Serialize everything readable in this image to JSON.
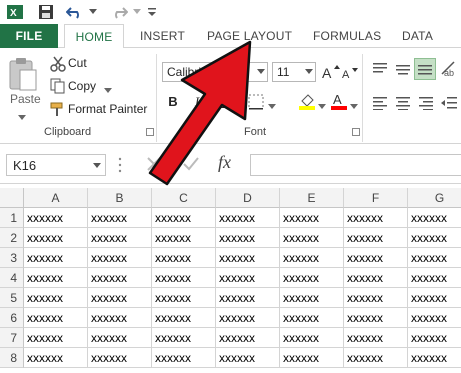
{
  "tabs": {
    "file": "FILE",
    "home": "HOME",
    "insert": "INSERT",
    "page_layout": "PAGE LAYOUT",
    "formulas": "FORMULAS",
    "data": "DATA"
  },
  "clipboard": {
    "paste": "Paste",
    "cut": "Cut",
    "copy": "Copy",
    "format_painter": "Format Painter",
    "group_label": "Clipboard"
  },
  "font": {
    "name": "Calibri",
    "size": "11",
    "group_label": "Font",
    "bold": "B",
    "italic": "I",
    "underline": "U"
  },
  "formula_bar": {
    "name_box": "K16",
    "fx": "fx"
  },
  "grid": {
    "columns": [
      "A",
      "B",
      "C",
      "D",
      "E",
      "F",
      "G"
    ],
    "rows": [
      "1",
      "2",
      "3",
      "4",
      "5",
      "6",
      "7",
      "8"
    ],
    "cell_text": "xxxxxx"
  },
  "colors": {
    "file_tab": "#217346",
    "accent": "#217346",
    "arrow": "#e0141c"
  }
}
